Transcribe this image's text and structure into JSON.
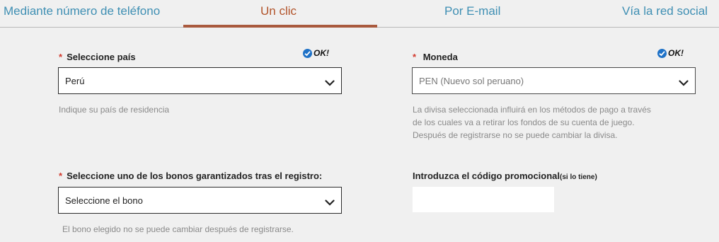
{
  "tabs": [
    {
      "label": "Mediante número de teléfono",
      "active": false
    },
    {
      "label": "Un clic",
      "active": true
    },
    {
      "label": "Por E-mail",
      "active": false
    },
    {
      "label": "Vía la red social",
      "active": false
    }
  ],
  "colors": {
    "tab_link": "#3f8fb3",
    "tab_active": "#b2542b",
    "underline": "#a95a3e",
    "required": "#d23b2f",
    "check": "#1f72c7",
    "background": "#f0f0f0"
  },
  "country": {
    "required_mark": "*",
    "label": "Seleccione país",
    "ok_text": "OK!",
    "value": "Perú",
    "help": "Indique su país de residencia",
    "icon": "chevron-down-icon"
  },
  "currency": {
    "required_mark": "*",
    "label": "Moneda",
    "ok_text": "OK!",
    "value": "PEN (Nuevo sol peruano)",
    "help_lines": [
      "La divisa seleccionada influirá en los métodos de pago a través",
      "de los cuales va a retirar los fondos de su cuenta de juego.",
      "Después de registrarse no se puede cambiar la divisa."
    ],
    "icon": "chevron-down-icon"
  },
  "bonus": {
    "required_mark": "*",
    "label": "Seleccione uno de los bonos garantizados tras el registro:",
    "value": "Seleccione el bono",
    "help": "El bono elegido no se puede cambiar después de registrarse.",
    "icon": "chevron-down-icon"
  },
  "promo": {
    "label": "Introduzca el código promocional",
    "label_small": "(si lo tiene)",
    "value": ""
  }
}
